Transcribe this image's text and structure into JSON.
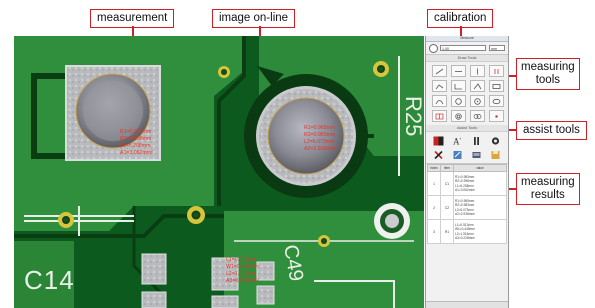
{
  "callouts": {
    "measurement": "measurement",
    "image_online": "image on-line",
    "calibration": "calibration",
    "measuring_tools_1": "measuring",
    "measuring_tools_2": "tools",
    "assist_tools": "assist tools",
    "measuring_results_1": "measuring",
    "measuring_results_2": "results"
  },
  "pcb_labels": {
    "c14": "C14",
    "r25": "R25",
    "c49": "C49"
  },
  "measurements": {
    "circle1": [
      "R1=0.983mm",
      "R2=0.998mm",
      "L1=6.208mm",
      "A1=3.062mm²"
    ],
    "circle2": [
      "R1=0.965mm",
      "R2=0.983mm",
      "L2=6.073mm",
      "A2=2.935mm²"
    ],
    "rect": [
      "L1=0.513mm",
      "W1=0.445mm",
      "L2=1.916mm",
      "A3=0.228mm²"
    ]
  },
  "panel": {
    "title": "Measure",
    "calibration_value": "1.00",
    "unit": "mm",
    "measure_tools_header": "Draw Tools",
    "assist_tools_header": "Assist Tools",
    "measure_tool_icons": [
      "line-icon",
      "horizontal-line-icon",
      "vertical-line-icon",
      "parallel-lines-icon",
      "polyline-icon",
      "angle-icon",
      "three-point-angle-icon",
      "rectangle-icon",
      "arc-icon",
      "circle-icon",
      "center-circle-icon",
      "ellipse-icon",
      "grid-icon",
      "concentric-circles-icon",
      "double-circle-icon",
      "point-icon"
    ],
    "assist_tool_icons": [
      "color-picker-icon",
      "text-icon",
      "pause-icon",
      "settings-icon",
      "delete-icon",
      "edit-icon",
      "export-icon",
      "save-icon"
    ]
  },
  "results": {
    "headers": [
      "index",
      "item",
      "value"
    ],
    "rows": [
      {
        "index": "1",
        "item": "C1",
        "values": [
          "R1=0.983mm",
          "R2=0.998mm",
          "L1=6.208mm",
          "A1=3.062mm²"
        ]
      },
      {
        "index": "2",
        "item": "C2",
        "values": [
          "R1=0.965mm",
          "R2=0.983mm",
          "L2=6.073mm",
          "A2=2.935mm²"
        ]
      },
      {
        "index": "3",
        "item": "R1",
        "values": [
          "L1=0.513mm",
          "W1=0.445mm",
          "L2=1.916mm",
          "A3=0.228mm²"
        ]
      }
    ]
  },
  "colors": {
    "callout_border": "#d01f26",
    "pcb_green": "#0d5a1e",
    "trace_green": "#3fa34d",
    "measure_red": "#e8342a"
  }
}
